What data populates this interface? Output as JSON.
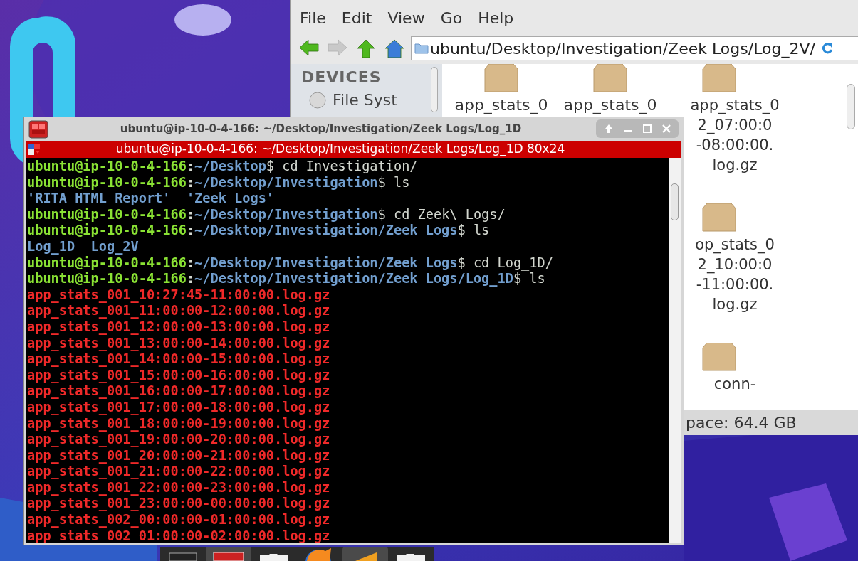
{
  "file_manager": {
    "menu": [
      "File",
      "Edit",
      "View",
      "Go",
      "Help"
    ],
    "nav_buttons": [
      {
        "kind": "back",
        "disabled": false
      },
      {
        "kind": "forward",
        "disabled": true
      },
      {
        "kind": "up",
        "disabled": false
      },
      {
        "kind": "home",
        "disabled": false
      }
    ],
    "address": "ubuntu/Desktop/Investigation/Zeek Logs/Log_2V/",
    "sidebar": {
      "heading": "DEVICES",
      "items": [
        "File Syst"
      ]
    },
    "files": [
      {
        "lines": [
          "app_stats_0"
        ]
      },
      {
        "lines": [
          "app_stats_0"
        ]
      },
      {
        "lines": [
          "app_stats_0",
          "2_07:00:0",
          "-08:00:00.",
          "log.gz"
        ]
      },
      {
        "lines": [
          "op_stats_0",
          "2_10:00:0",
          "-11:00:00.",
          "log.gz"
        ]
      },
      {
        "lines": [
          "conn-"
        ]
      }
    ],
    "status": "pace: 64.4 GB"
  },
  "terminal": {
    "title": "ubuntu@ip-10-0-4-166: ~/Desktop/Investigation/Zeek Logs/Log_1D",
    "tab_title": "ubuntu@ip-10-0-4-166: ~/Desktop/Investigation/Zeek Logs/Log_1D 80x24",
    "lines": [
      {
        "kind": "prompt",
        "user": "ubuntu@ip-10-0-4-166",
        "sep": ":",
        "path": "~/Desktop",
        "command": "$ cd Investigation/"
      },
      {
        "kind": "prompt",
        "user": "ubuntu@ip-10-0-4-166",
        "sep": ":",
        "path": "~/Desktop/Investigation",
        "command": "$ ls"
      },
      {
        "kind": "dir",
        "text": "'RITA HTML Report'  'Zeek Logs'"
      },
      {
        "kind": "prompt",
        "user": "ubuntu@ip-10-0-4-166",
        "sep": ":",
        "path": "~/Desktop/Investigation",
        "command": "$ cd Zeek\\ Logs/"
      },
      {
        "kind": "prompt",
        "user": "ubuntu@ip-10-0-4-166",
        "sep": ":",
        "path": "~/Desktop/Investigation/Zeek Logs",
        "command": "$ ls"
      },
      {
        "kind": "dir",
        "text": "Log_1D  Log_2V"
      },
      {
        "kind": "prompt",
        "user": "ubuntu@ip-10-0-4-166",
        "sep": ":",
        "path": "~/Desktop/Investigation/Zeek Logs",
        "command": "$ cd Log_1D/"
      },
      {
        "kind": "prompt",
        "user": "ubuntu@ip-10-0-4-166",
        "sep": ":",
        "path": "~/Desktop/Investigation/Zeek Logs/Log_1D",
        "command": "$ ls"
      },
      {
        "kind": "file",
        "text": "app_stats_001_10:27:45-11:00:00.log.gz"
      },
      {
        "kind": "file",
        "text": "app_stats_001_11:00:00-12:00:00.log.gz"
      },
      {
        "kind": "file",
        "text": "app_stats_001_12:00:00-13:00:00.log.gz"
      },
      {
        "kind": "file",
        "text": "app_stats_001_13:00:00-14:00:00.log.gz"
      },
      {
        "kind": "file",
        "text": "app_stats_001_14:00:00-15:00:00.log.gz"
      },
      {
        "kind": "file",
        "text": "app_stats_001_15:00:00-16:00:00.log.gz"
      },
      {
        "kind": "file",
        "text": "app_stats_001_16:00:00-17:00:00.log.gz"
      },
      {
        "kind": "file",
        "text": "app_stats_001_17:00:00-18:00:00.log.gz"
      },
      {
        "kind": "file",
        "text": "app_stats_001_18:00:00-19:00:00.log.gz"
      },
      {
        "kind": "file",
        "text": "app_stats_001_19:00:00-20:00:00.log.gz"
      },
      {
        "kind": "file",
        "text": "app_stats_001_20:00:00-21:00:00.log.gz"
      },
      {
        "kind": "file",
        "text": "app_stats_001_21:00:00-22:00:00.log.gz"
      },
      {
        "kind": "file",
        "text": "app_stats_001_22:00:00-23:00:00.log.gz"
      },
      {
        "kind": "file",
        "text": "app_stats_001_23:00:00-00:00:00.log.gz"
      },
      {
        "kind": "file",
        "text": "app_stats_002_00:00:00-01:00:00.log.gz"
      },
      {
        "kind": "file",
        "text": "app_stats_002_01:00:00-02:00:00.log.gz"
      }
    ]
  },
  "taskbar": [
    {
      "kind": "terminal",
      "selected": false
    },
    {
      "kind": "terminal-app",
      "selected": true
    },
    {
      "kind": "folder",
      "selected": false
    },
    {
      "kind": "browser",
      "selected": false
    },
    {
      "kind": "editor",
      "selected": true
    },
    {
      "kind": "folder",
      "selected": false
    }
  ]
}
